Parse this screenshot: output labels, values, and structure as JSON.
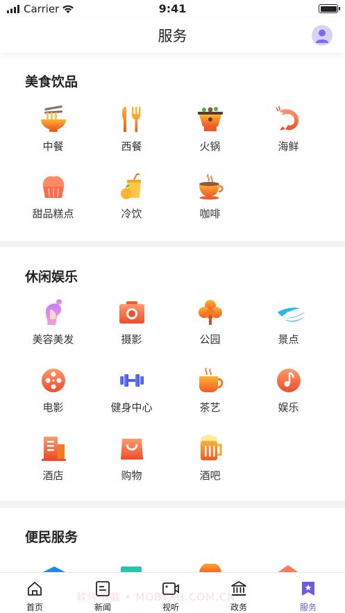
{
  "status_bar": {
    "carrier": "Carrier",
    "time": "9:41"
  },
  "nav": {
    "title": "服务"
  },
  "sections": [
    {
      "title": "美食饮品",
      "items": [
        "中餐",
        "西餐",
        "火锅",
        "海鲜",
        "甜品糕点",
        "冷饮",
        "咖啡"
      ]
    },
    {
      "title": "休闲娱乐",
      "items": [
        "美容美发",
        "摄影",
        "公园",
        "景点",
        "电影",
        "健身中心",
        "茶艺",
        "娱乐",
        "酒店",
        "购物",
        "酒吧"
      ]
    },
    {
      "title": "便民服务"
    }
  ],
  "icons": {
    "food": [
      "noodle-bowl-icon",
      "fork-knife-icon",
      "hotpot-icon",
      "shrimp-icon",
      "cupcake-icon",
      "cold-drink-icon",
      "coffee-cup-icon"
    ],
    "leisure": [
      "beauty-salon-icon",
      "camera-icon",
      "tree-icon",
      "scenic-wave-icon",
      "film-reel-icon",
      "dumbbell-icon",
      "teapot-icon",
      "music-note-icon",
      "hotel-building-icon",
      "shopping-bag-icon",
      "beer-mug-icon"
    ]
  },
  "tabs": [
    {
      "label": "首页",
      "icon": "home-icon"
    },
    {
      "label": "新闻",
      "icon": "news-icon"
    },
    {
      "label": "视听",
      "icon": "video-icon"
    },
    {
      "label": "政务",
      "icon": "government-icon"
    },
    {
      "label": "服务",
      "icon": "service-star-icon",
      "active": true
    }
  ],
  "watermark": "软件下载 • MOBYXH.COM.CN",
  "colors": {
    "accent": "#6b5ce7",
    "orange": "#f47a22",
    "icon_gradient_top": "#ffb233",
    "icon_gradient_bottom": "#f15a24"
  }
}
